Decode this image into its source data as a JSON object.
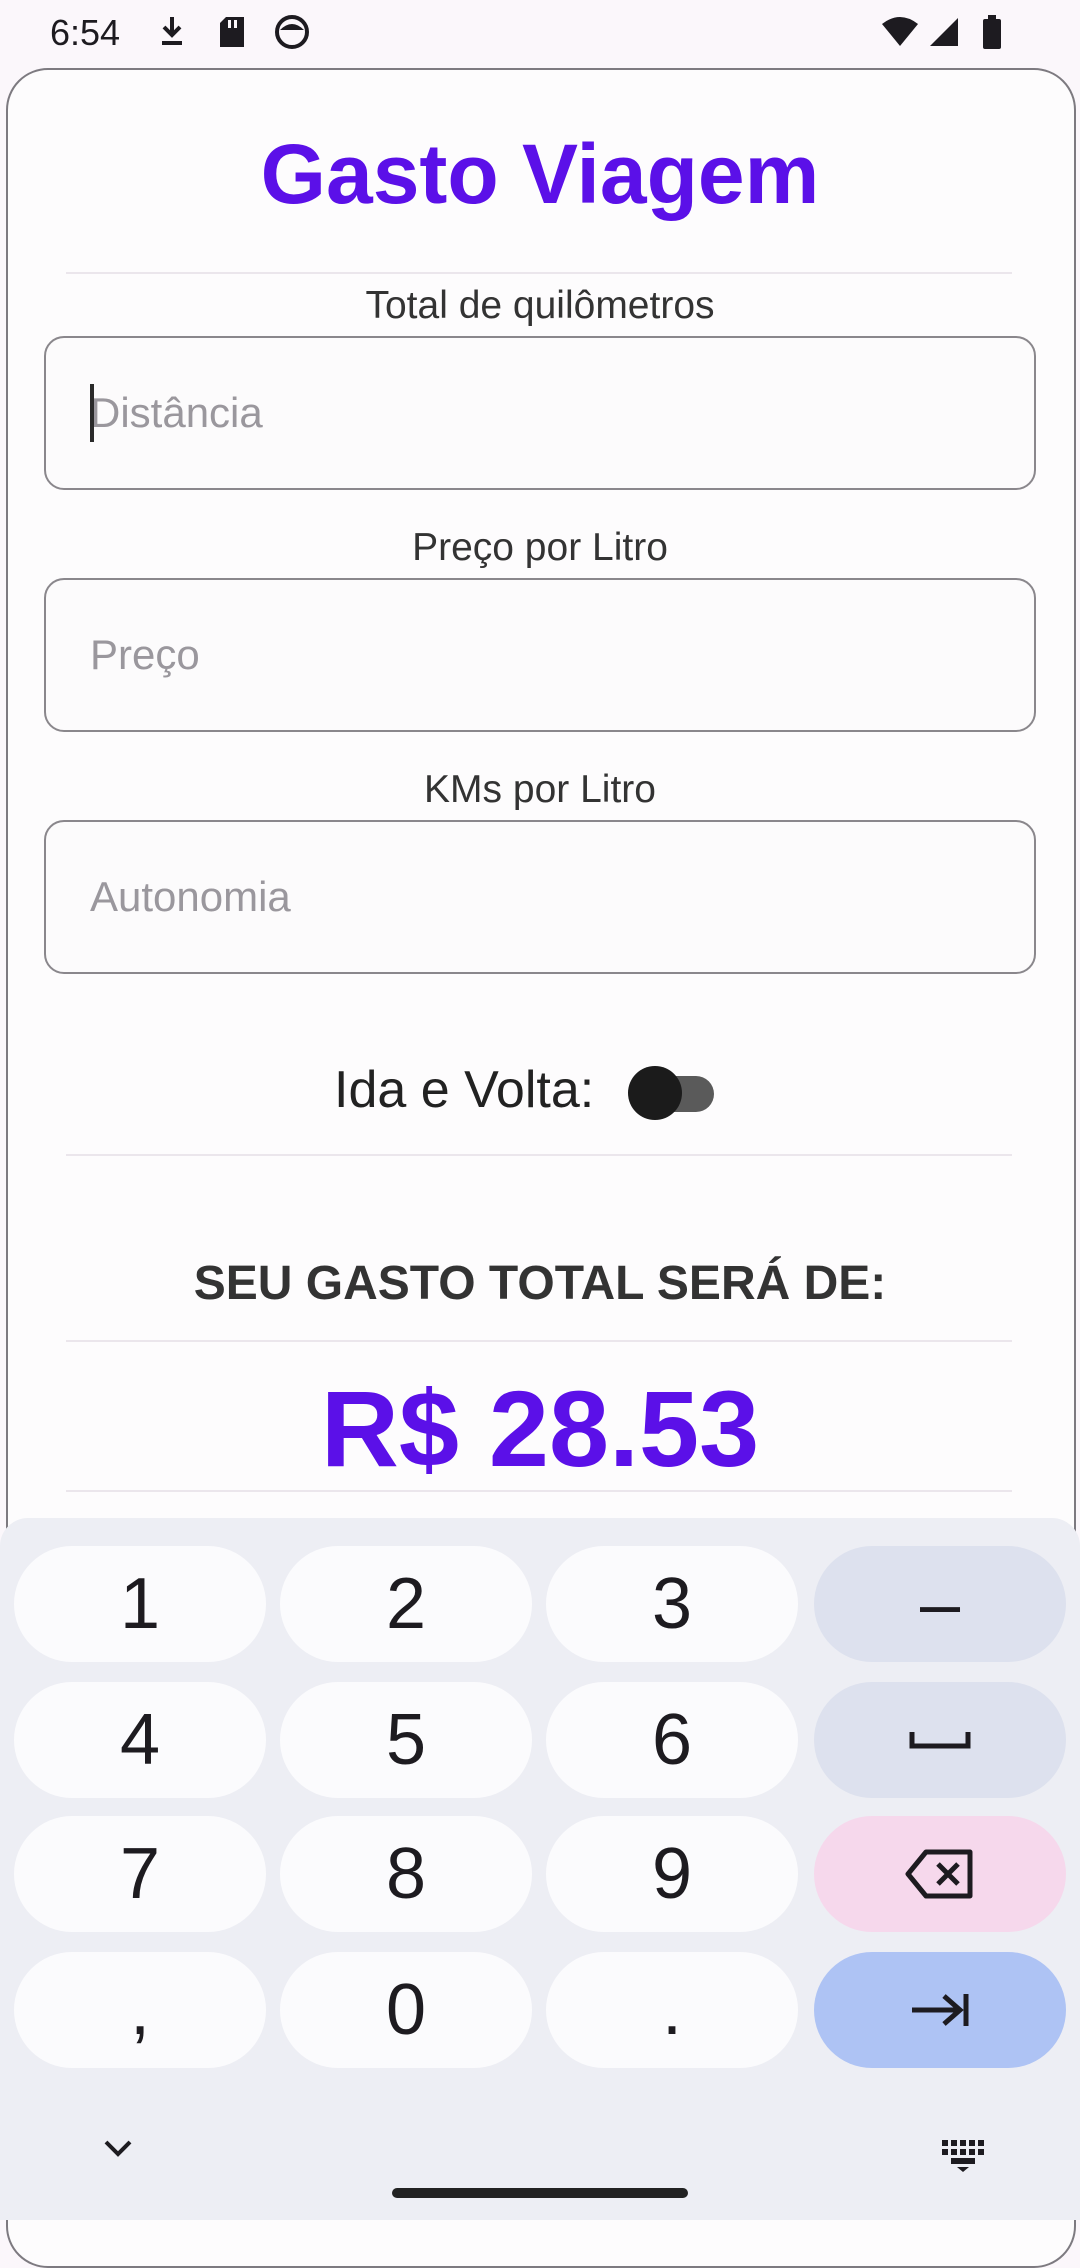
{
  "status_bar": {
    "time": "6:54",
    "icons_left": [
      "download-icon",
      "sd-card-icon",
      "face-icon"
    ],
    "icons_right": [
      "wifi-icon",
      "signal-icon",
      "battery-icon"
    ]
  },
  "app": {
    "title": "Gasto Viagem",
    "fields": [
      {
        "label": "Total de quilômetros",
        "placeholder": "Distância",
        "value": ""
      },
      {
        "label": "Preço por Litro",
        "placeholder": "Preço",
        "value": ""
      },
      {
        "label": "KMs por Litro",
        "placeholder": "Autonomia",
        "value": ""
      }
    ],
    "round_trip": {
      "label": "Ida e Volta:",
      "on": false
    },
    "result": {
      "heading": "SEU GASTO TOTAL SERÁ DE:",
      "value": "R$ 28.53"
    },
    "accent_color": "#5b10e8"
  },
  "keyboard": {
    "keys": [
      [
        "1",
        "2",
        "3",
        "–"
      ],
      [
        "4",
        "5",
        "6",
        "space"
      ],
      [
        "7",
        "8",
        "9",
        "backspace"
      ],
      [
        ",",
        "0",
        ".",
        "next"
      ]
    ],
    "digit_labels": {
      "k1": "1",
      "k2": "2",
      "k3": "3",
      "minus": "–",
      "k4": "4",
      "k5": "5",
      "k6": "6",
      "k7": "7",
      "k8": "8",
      "k9": "9",
      "comma": ",",
      "k0": "0",
      "period": "."
    }
  }
}
